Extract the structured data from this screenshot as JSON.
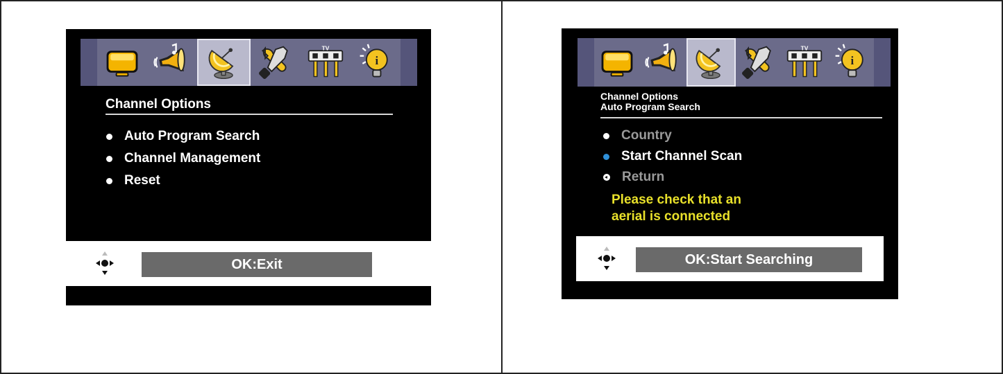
{
  "panels": [
    {
      "title_lines": [
        "Channel Options"
      ],
      "menu": [
        {
          "label": "Auto Program Search"
        },
        {
          "label": "Channel Management"
        },
        {
          "label": "Reset"
        }
      ],
      "ok_label": "OK:Exit"
    },
    {
      "title_lines": [
        "Channel Options",
        "Auto Program Search"
      ],
      "menu": [
        {
          "label": "Country"
        },
        {
          "label": "Start Channel Scan"
        },
        {
          "label": "Return"
        }
      ],
      "warning_lines": [
        "Please check that an",
        "aerial is connected"
      ],
      "ok_label": "OK:Start Searching"
    }
  ],
  "iconbar": {
    "icons": [
      "picture-icon",
      "sound-icon",
      "channel-icon",
      "setup-icon",
      "input-icon",
      "info-icon"
    ],
    "selected": "channel-icon"
  },
  "colors": {
    "screen_bg": "#000000",
    "iconbar_bg": "#6b6b8a",
    "selected_cell": "#b9b9cc",
    "warning_text": "#e8e02a",
    "highlight_bullet": "#2f8fd8",
    "ok_box_bg": "#6a6a6a"
  }
}
